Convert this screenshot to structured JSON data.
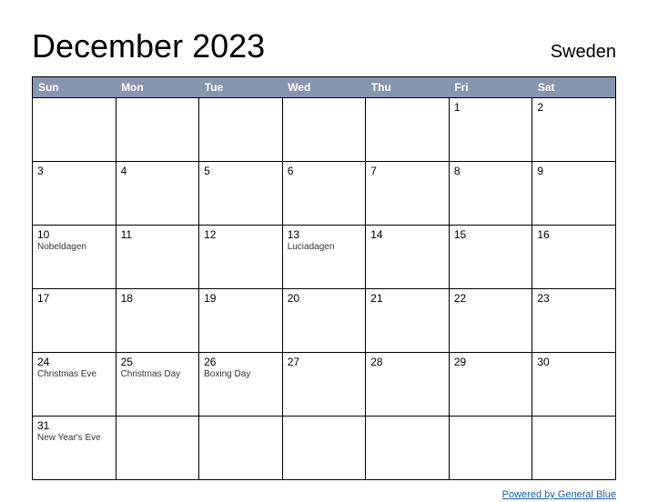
{
  "title": "December 2023",
  "country": "Sweden",
  "weekdays": [
    "Sun",
    "Mon",
    "Tue",
    "Wed",
    "Thu",
    "Fri",
    "Sat"
  ],
  "weeks": [
    [
      {
        "day": "",
        "event": ""
      },
      {
        "day": "",
        "event": ""
      },
      {
        "day": "",
        "event": ""
      },
      {
        "day": "",
        "event": ""
      },
      {
        "day": "",
        "event": ""
      },
      {
        "day": "1",
        "event": ""
      },
      {
        "day": "2",
        "event": ""
      }
    ],
    [
      {
        "day": "3",
        "event": ""
      },
      {
        "day": "4",
        "event": ""
      },
      {
        "day": "5",
        "event": ""
      },
      {
        "day": "6",
        "event": ""
      },
      {
        "day": "7",
        "event": ""
      },
      {
        "day": "8",
        "event": ""
      },
      {
        "day": "9",
        "event": ""
      }
    ],
    [
      {
        "day": "10",
        "event": "Nobeldagen"
      },
      {
        "day": "11",
        "event": ""
      },
      {
        "day": "12",
        "event": ""
      },
      {
        "day": "13",
        "event": "Luciadagen"
      },
      {
        "day": "14",
        "event": ""
      },
      {
        "day": "15",
        "event": ""
      },
      {
        "day": "16",
        "event": ""
      }
    ],
    [
      {
        "day": "17",
        "event": ""
      },
      {
        "day": "18",
        "event": ""
      },
      {
        "day": "19",
        "event": ""
      },
      {
        "day": "20",
        "event": ""
      },
      {
        "day": "21",
        "event": ""
      },
      {
        "day": "22",
        "event": ""
      },
      {
        "day": "23",
        "event": ""
      }
    ],
    [
      {
        "day": "24",
        "event": "Christmas Eve"
      },
      {
        "day": "25",
        "event": "Christmas Day"
      },
      {
        "day": "26",
        "event": "Boxing Day"
      },
      {
        "day": "27",
        "event": ""
      },
      {
        "day": "28",
        "event": ""
      },
      {
        "day": "29",
        "event": ""
      },
      {
        "day": "30",
        "event": ""
      }
    ],
    [
      {
        "day": "31",
        "event": "New Year's Eve"
      },
      {
        "day": "",
        "event": ""
      },
      {
        "day": "",
        "event": ""
      },
      {
        "day": "",
        "event": ""
      },
      {
        "day": "",
        "event": ""
      },
      {
        "day": "",
        "event": ""
      },
      {
        "day": "",
        "event": ""
      }
    ]
  ],
  "credit": "Powered by General Blue"
}
